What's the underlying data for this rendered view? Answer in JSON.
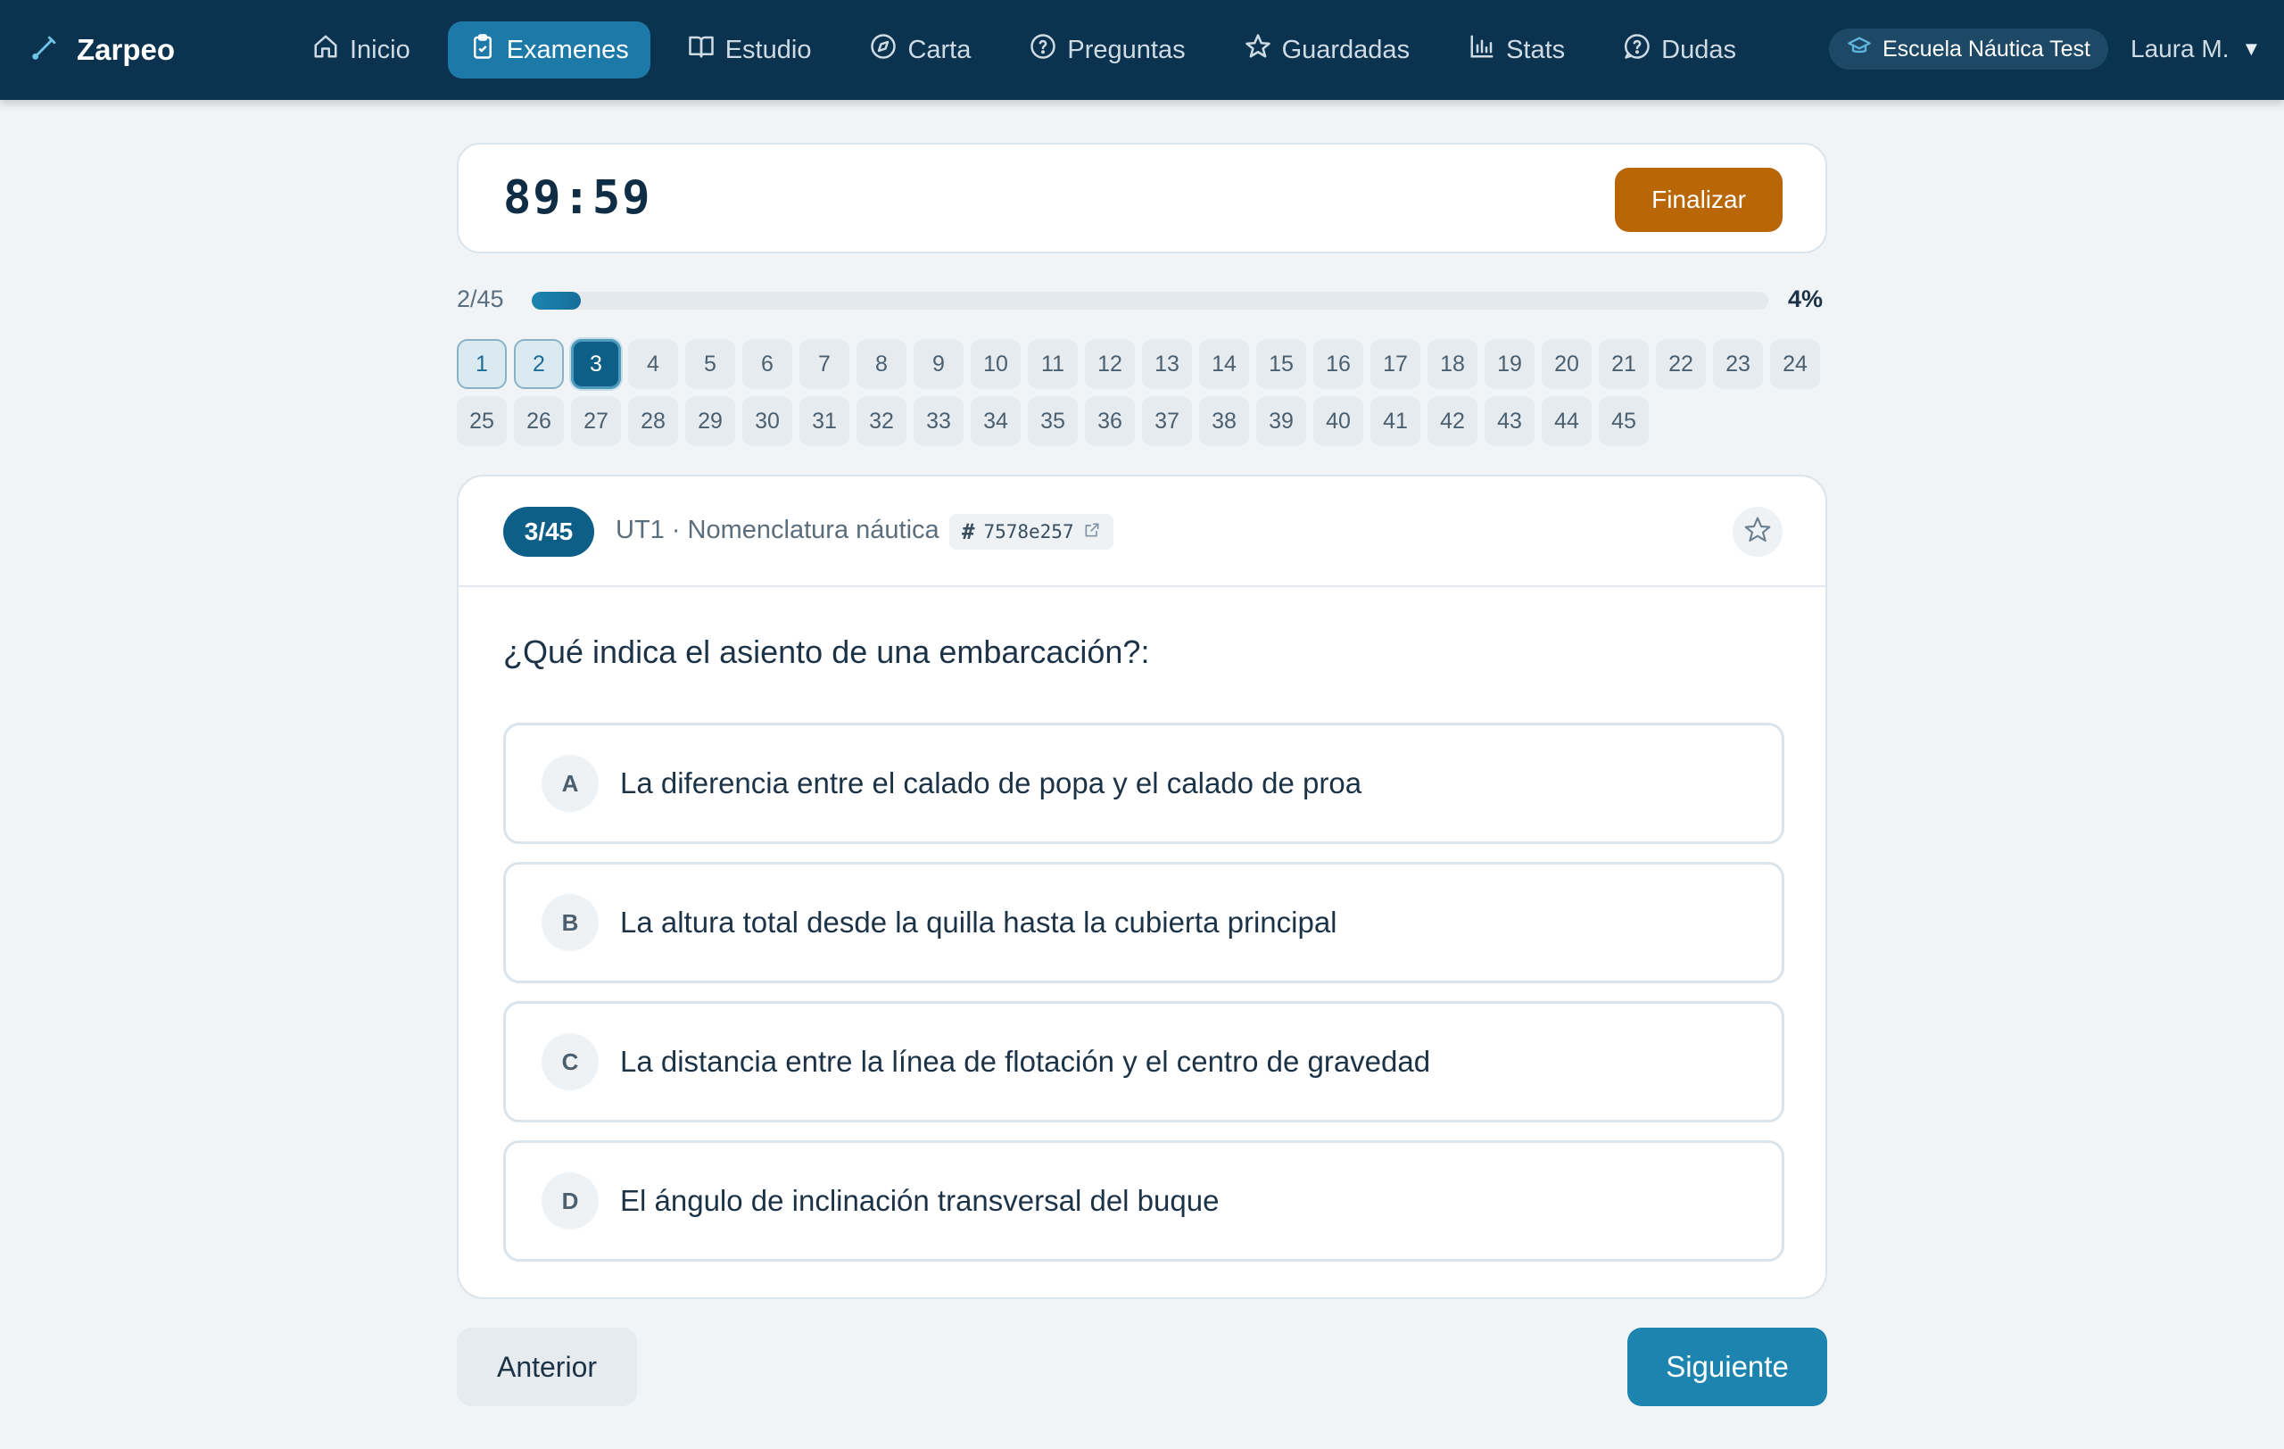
{
  "app": {
    "name": "Zarpeo"
  },
  "nav": {
    "items": [
      {
        "label": "Inicio",
        "icon": "home-icon",
        "active": false
      },
      {
        "label": "Examenes",
        "icon": "clipboard-check-icon",
        "active": true
      },
      {
        "label": "Estudio",
        "icon": "book-open-icon",
        "active": false
      },
      {
        "label": "Carta",
        "icon": "compass-icon",
        "active": false
      },
      {
        "label": "Preguntas",
        "icon": "help-circle-icon",
        "active": false
      },
      {
        "label": "Guardadas",
        "icon": "star-icon",
        "active": false
      },
      {
        "label": "Stats",
        "icon": "bar-chart-icon",
        "active": false
      },
      {
        "label": "Dudas",
        "icon": "question-bubble-icon",
        "active": false
      }
    ],
    "school": "Escuela Náutica Test",
    "user": "Laura M."
  },
  "exam": {
    "timer": "89:59",
    "finish_label": "Finalizar",
    "progress_label": "2/45",
    "progress_percent_label": "4%",
    "progress_fraction": 0.04,
    "questions": {
      "total": 45,
      "answered": [
        1,
        2
      ],
      "current": 3
    }
  },
  "question": {
    "number_badge": "3/45",
    "topic": "UT1 · Nomenclatura náutica",
    "id": "7578e257",
    "id_hash": "#",
    "text": "¿Qué indica el asiento de una embarcación?:",
    "options": [
      {
        "letter": "A",
        "text": "La diferencia entre el calado de popa y el calado de proa"
      },
      {
        "letter": "B",
        "text": "La altura total desde la quilla hasta la cubierta principal"
      },
      {
        "letter": "C",
        "text": "La distancia entre la línea de flotación y el centro de gravedad"
      },
      {
        "letter": "D",
        "text": "El ángulo de inclinación transversal del buque"
      }
    ]
  },
  "footer": {
    "prev_label": "Anterior",
    "next_label": "Siguiente"
  },
  "colors": {
    "navbar": "#0b3350",
    "accent": "#1d84b0",
    "primary_dark": "#0e5f88",
    "finish": "#b86606",
    "background": "#f1f4f6"
  }
}
